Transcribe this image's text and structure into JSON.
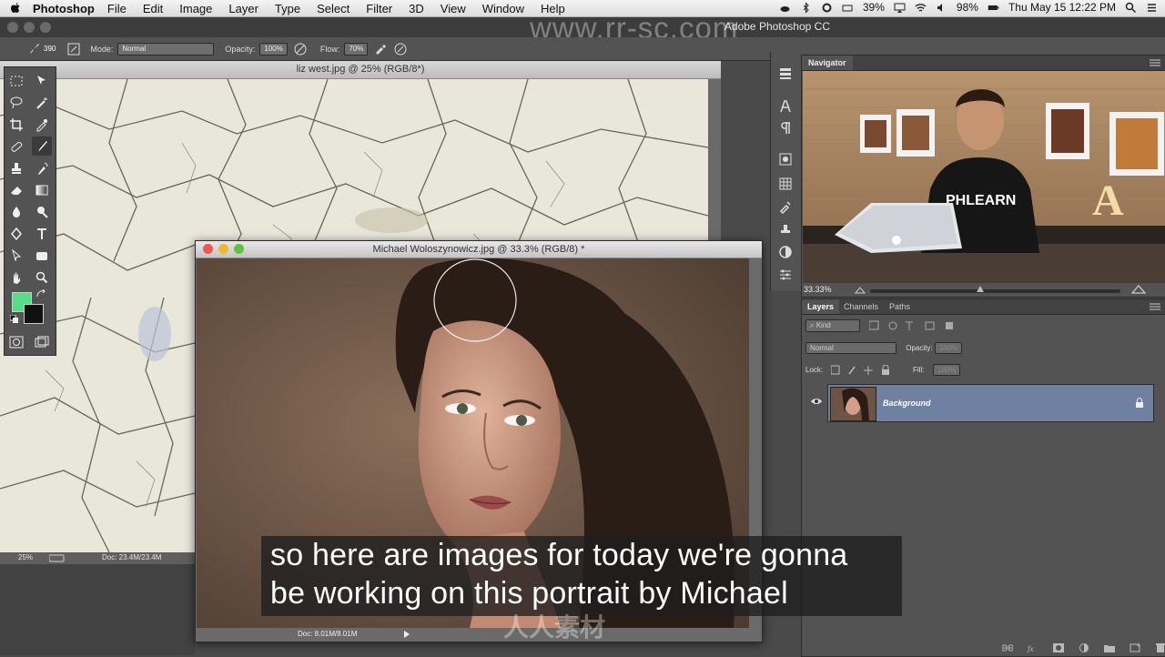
{
  "menubar": {
    "app_name": "Photoshop",
    "items": [
      "File",
      "Edit",
      "Image",
      "Layer",
      "Type",
      "Select",
      "Filter",
      "3D",
      "View",
      "Window",
      "Help"
    ],
    "battery_small": "39%",
    "battery_main": "98%",
    "clock": "Thu May 15  12:22 PM"
  },
  "appbar": {
    "title": "Adobe Photoshop CC"
  },
  "watermark": "www.rr-sc.com",
  "options": {
    "brush_size": "390",
    "mode_label": "Mode:",
    "mode_value": "Normal",
    "opacity_label": "Opacity:",
    "opacity_value": "100%",
    "flow_label": "Flow:",
    "flow_value": "70%"
  },
  "doc1": {
    "tab_title": "liz west.jpg @ 25% (RGB/8*)",
    "zoom": "25%",
    "doc_size": "Doc: 23.4M/23.4M"
  },
  "doc2": {
    "tab_title": "Michael Woloszynowicz.jpg @ 33.3% (RGB/8) *",
    "doc_size": "Doc: 8.01M/8.01M"
  },
  "navigator": {
    "tab": "Navigator",
    "zoom": "33.33%",
    "zoom_fraction": 0.4,
    "shirt_text": "PHLEARN",
    "sign_letter": "A"
  },
  "layers_panel": {
    "tabs": [
      "Layers",
      "Channels",
      "Paths"
    ],
    "filter_label": "Kind",
    "blend_mode": "Normal",
    "opacity_label": "Opacity:",
    "opacity_value": "100%",
    "lock_label": "Lock:",
    "fill_label": "Fill:",
    "fill_value": "100%",
    "layer_name": "Background"
  },
  "caption": {
    "line1": "so here are images for today we're gonna",
    "line2": "be working on this portrait by Michael"
  },
  "bottom_watermark": "人人素材",
  "colors": {
    "foreground": "#55dd88",
    "background": "#111111",
    "layer_selected": "#7080a0"
  }
}
